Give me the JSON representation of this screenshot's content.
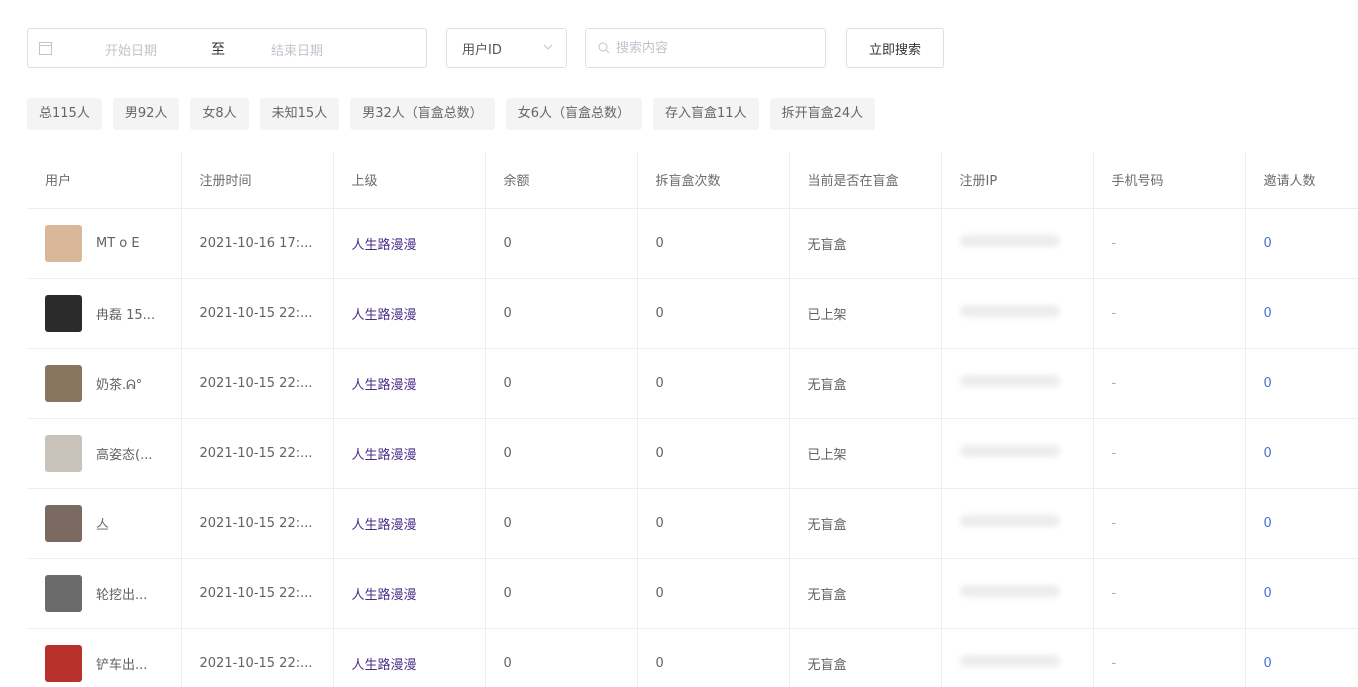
{
  "filters": {
    "start_placeholder": "开始日期",
    "separator": "至",
    "end_placeholder": "结束日期",
    "select_value": "用户ID",
    "search_placeholder": "搜索内容",
    "search_button": "立即搜索"
  },
  "stats": [
    "总115人",
    "男92人",
    "女8人",
    "未知15人",
    "男32人（盲盒总数）",
    "女6人（盲盒总数）",
    "存入盲盒11人",
    "拆开盲盒24人"
  ],
  "table": {
    "columns": [
      "用户",
      "注册时间",
      "上级",
      "余额",
      "拆盲盒次数",
      "当前是否在盲盒",
      "注册IP",
      "手机号码",
      "邀请人数"
    ],
    "rows": [
      {
        "user": "MT o E",
        "time": "2021-10-16 17:...",
        "parent": "人生路漫漫",
        "balance": "0",
        "opens": "0",
        "status": "无盲盒",
        "phone": "-",
        "invites": "0",
        "avatar_color": "#d9b89a"
      },
      {
        "user": "冉磊 15...",
        "time": "2021-10-15 22:...",
        "parent": "人生路漫漫",
        "balance": "0",
        "opens": "0",
        "status": "已上架",
        "phone": "-",
        "invites": "0",
        "avatar_color": "#2b2b2b"
      },
      {
        "user": "奶茶.ᕱ°",
        "time": "2021-10-15 22:...",
        "parent": "人生路漫漫",
        "balance": "0",
        "opens": "0",
        "status": "无盲盒",
        "phone": "-",
        "invites": "0",
        "avatar_color": "#8a7560"
      },
      {
        "user": "高姿态(...",
        "time": "2021-10-15 22:...",
        "parent": "人生路漫漫",
        "balance": "0",
        "opens": "0",
        "status": "已上架",
        "phone": "-",
        "invites": "0",
        "avatar_color": "#c9c2bb"
      },
      {
        "user": "亼",
        "time": "2021-10-15 22:...",
        "parent": "人生路漫漫",
        "balance": "0",
        "opens": "0",
        "status": "无盲盒",
        "phone": "-",
        "invites": "0",
        "avatar_color": "#7a6a62"
      },
      {
        "user": "轮挖出...",
        "time": "2021-10-15 22:...",
        "parent": "人生路漫漫",
        "balance": "0",
        "opens": "0",
        "status": "无盲盒",
        "phone": "-",
        "invites": "0",
        "avatar_color": "#6b6b6b"
      },
      {
        "user": "铲车出...",
        "time": "2021-10-15 22:...",
        "parent": "人生路漫漫",
        "balance": "0",
        "opens": "0",
        "status": "无盲盒",
        "phone": "-",
        "invites": "0",
        "avatar_color": "#b8312a"
      }
    ]
  }
}
